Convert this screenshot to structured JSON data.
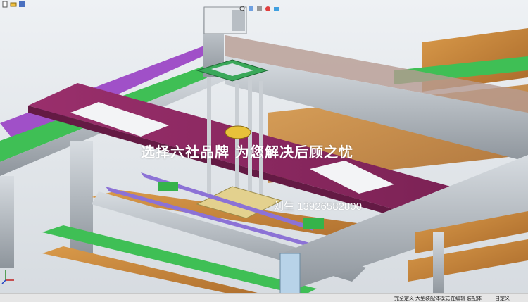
{
  "toolbar": {
    "icons": [
      "new-document-icon",
      "open-folder-icon",
      "save-icon",
      "print-icon",
      "undo-icon",
      "select-arrow-icon",
      "rebuild-icon",
      "options-icon"
    ]
  },
  "view_toolbar": {
    "icons": [
      "zoom-to-fit-icon",
      "zoom-area-icon",
      "previous-view-icon",
      "section-view-icon",
      "view-orientation-icon",
      "display-style-icon",
      "hide-show-icon",
      "edit-appearance-icon",
      "scene-icon",
      "view-settings-icon"
    ]
  },
  "viewport": {
    "overlay_text": "选择六社品牌 为您解决后顾之忧",
    "contact_text": "刘生  13926582800"
  },
  "status_bar": {
    "items": [
      "完全定义",
      "大型装配体模式",
      "在编辑 装配体",
      "自定义"
    ]
  },
  "colors": {
    "magenta_plate": "#8e2a63",
    "orange_wood": "#c98a3e",
    "green_rail": "#3fbf55",
    "purple_rail": "#a050c8",
    "aluminum": "#b9bfc6",
    "yellow_plate": "#e3d18e"
  }
}
